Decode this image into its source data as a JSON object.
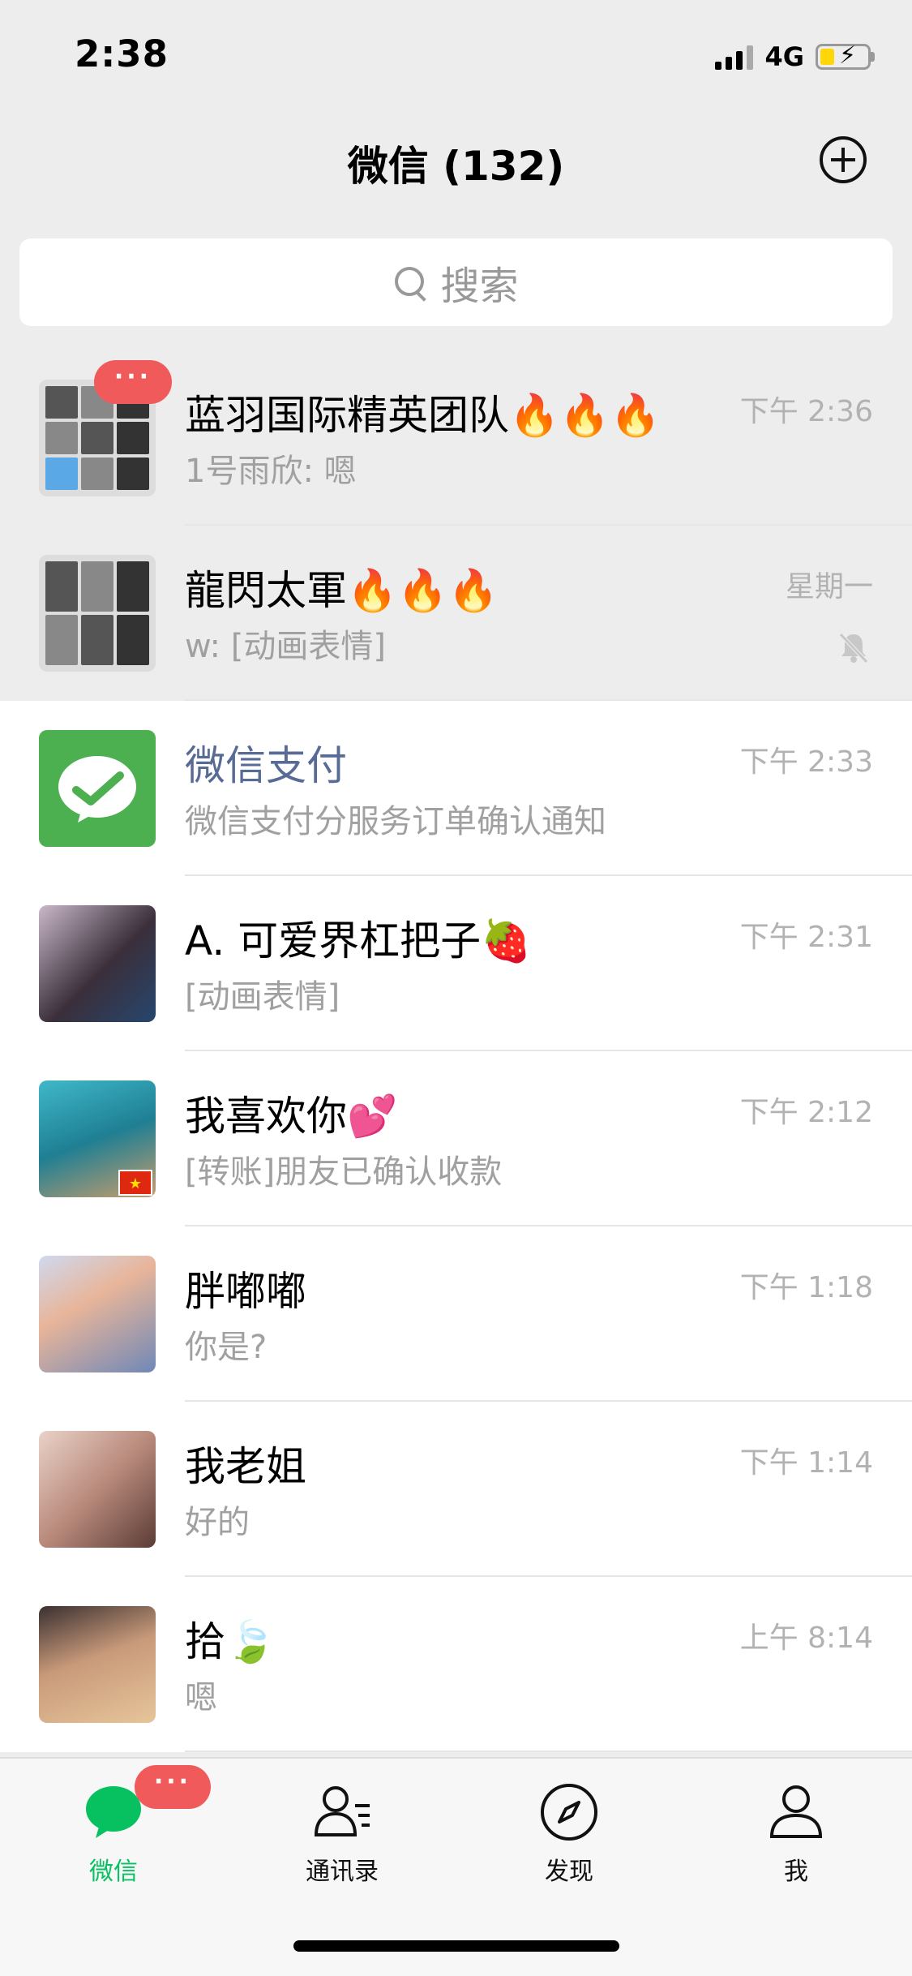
{
  "status": {
    "time": "2:38",
    "network": "4G"
  },
  "header": {
    "title": "微信 (132)"
  },
  "search": {
    "placeholder": "搜索"
  },
  "chats": [
    {
      "title": "蓝羽国际精英团队",
      "title_emoji": "🔥🔥🔥",
      "preview": "1号雨欣: 嗯",
      "time": "下午 2:36",
      "badge": "···"
    },
    {
      "title": "龍閃太軍",
      "title_emoji": "🔥🔥🔥",
      "preview": "w: [动画表情]",
      "time": "星期一",
      "muted": true
    },
    {
      "title": "微信支付",
      "preview": "微信支付分服务订单确认通知",
      "time": "下午 2:33"
    },
    {
      "title": "A. 可爱界杠把子",
      "title_emoji": "🍓",
      "preview": "[动画表情]",
      "time": "下午 2:31"
    },
    {
      "title": "我喜欢你",
      "title_emoji": "💕",
      "preview": "[转账]朋友已确认收款",
      "time": "下午 2:12"
    },
    {
      "title": "胖嘟嘟",
      "preview": "你是?",
      "time": "下午 1:18"
    },
    {
      "title": "我老姐",
      "preview": "好的",
      "time": "下午 1:14"
    },
    {
      "title": "拾",
      "title_emoji": "🍃",
      "preview": "嗯",
      "time": "上午 8:14"
    }
  ],
  "tabbar": {
    "tabs": [
      {
        "label": "微信"
      },
      {
        "label": "通讯录"
      },
      {
        "label": "发现"
      },
      {
        "label": "我"
      }
    ],
    "badge": "···"
  },
  "colors": {
    "accent": "#07c160",
    "badge": "#f05a5a",
    "link": "#576b95",
    "background": "#ededed"
  }
}
